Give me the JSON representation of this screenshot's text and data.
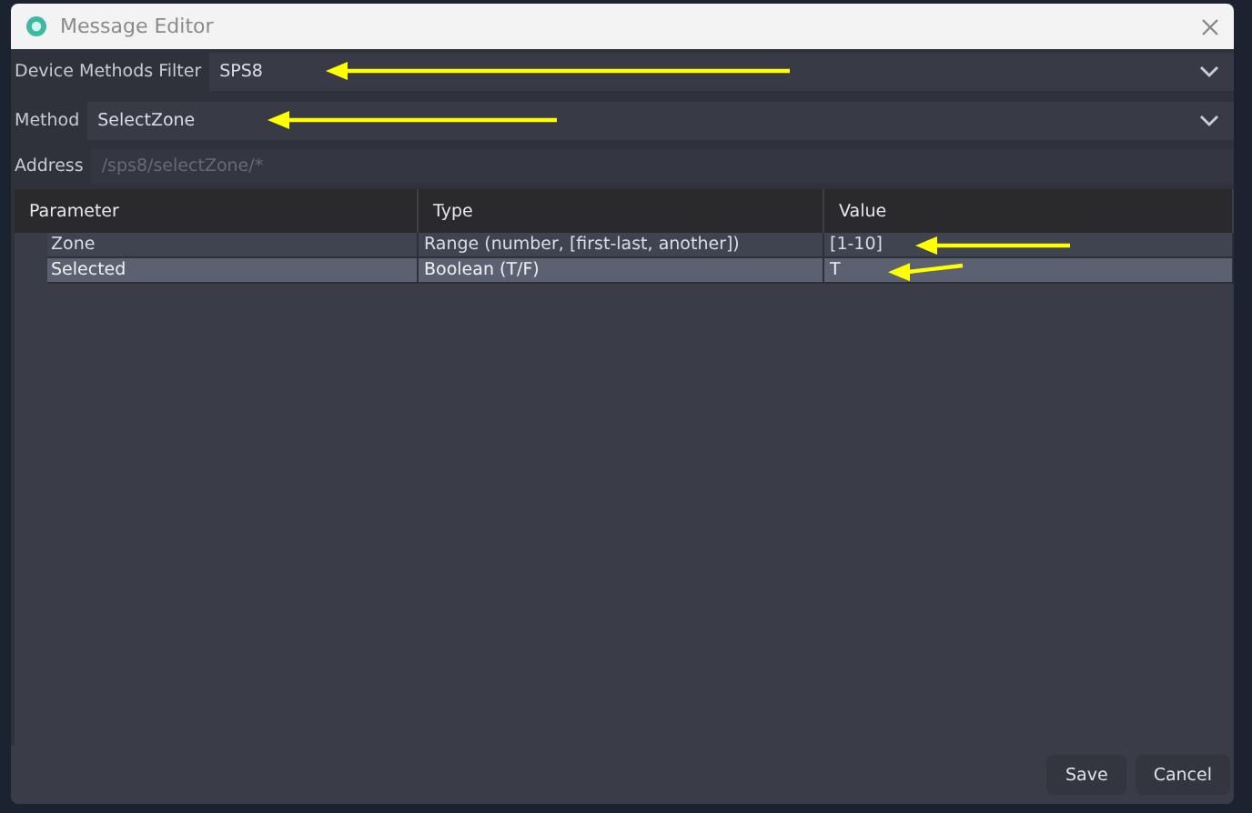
{
  "window": {
    "title": "Message Editor"
  },
  "filter": {
    "label": "Device Methods Filter",
    "value": "SPS8",
    "highlighted": true
  },
  "method": {
    "label": "Method",
    "value": "SelectZone",
    "highlighted": true
  },
  "address": {
    "label": "Address",
    "placeholder": "/sps8/selectZone/*"
  },
  "table": {
    "columns": [
      "Parameter",
      "Type",
      "Value"
    ],
    "rows": [
      {
        "parameter": "Zone",
        "type": "Range (number, [first-last, another])",
        "value": "[1-10]",
        "selected": false,
        "highlighted": true
      },
      {
        "parameter": "Selected",
        "type": "Boolean (T/F)",
        "value": "T",
        "selected": true,
        "highlighted": true
      }
    ]
  },
  "buttons": [
    "Save",
    "Cancel"
  ]
}
